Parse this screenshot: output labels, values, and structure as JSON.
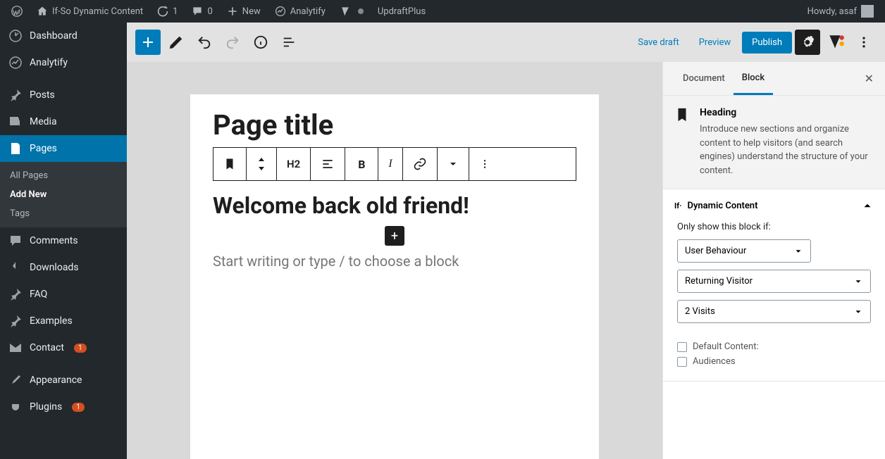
{
  "topbar": {
    "site_name": "If-So Dynamic Content",
    "updates_count": "1",
    "comments_count": "0",
    "new_label": "New",
    "analytify_label": "Analytify",
    "updraft_label": "UpdraftPlus",
    "howdy": "Howdy, asaf"
  },
  "sidebar": {
    "items": [
      {
        "label": "Dashboard"
      },
      {
        "label": "Analytify"
      },
      {
        "label": "Posts"
      },
      {
        "label": "Media"
      },
      {
        "label": "Pages"
      },
      {
        "label": "Comments"
      },
      {
        "label": "Downloads"
      },
      {
        "label": "FAQ"
      },
      {
        "label": "Examples"
      },
      {
        "label": "Contact",
        "badge": "1"
      },
      {
        "label": "Appearance"
      },
      {
        "label": "Plugins",
        "badge": "1"
      }
    ],
    "sub": {
      "all": "All Pages",
      "add": "Add New",
      "tags": "Tags"
    }
  },
  "toolbar": {
    "save_draft": "Save draft",
    "preview": "Preview",
    "publish": "Publish"
  },
  "editor": {
    "page_title": "Page title",
    "h2_label": "H2",
    "heading_text": "Welcome back old friend!",
    "placeholder": "Start writing or type / to choose a block"
  },
  "inspector": {
    "tabs": {
      "document": "Document",
      "block": "Block"
    },
    "panel": {
      "title": "Heading",
      "desc": "Introduce new sections and organize content to help visitors (and search engines) understand the structure of your content."
    },
    "dynamic": {
      "section_title": "Dynamic Content",
      "field_label": "Only show this block if:",
      "select1": "User Behaviour",
      "select2": "Returning Visitor",
      "select3": "2 Visits",
      "chk1": "Default Content:",
      "chk2": "Audiences"
    }
  }
}
